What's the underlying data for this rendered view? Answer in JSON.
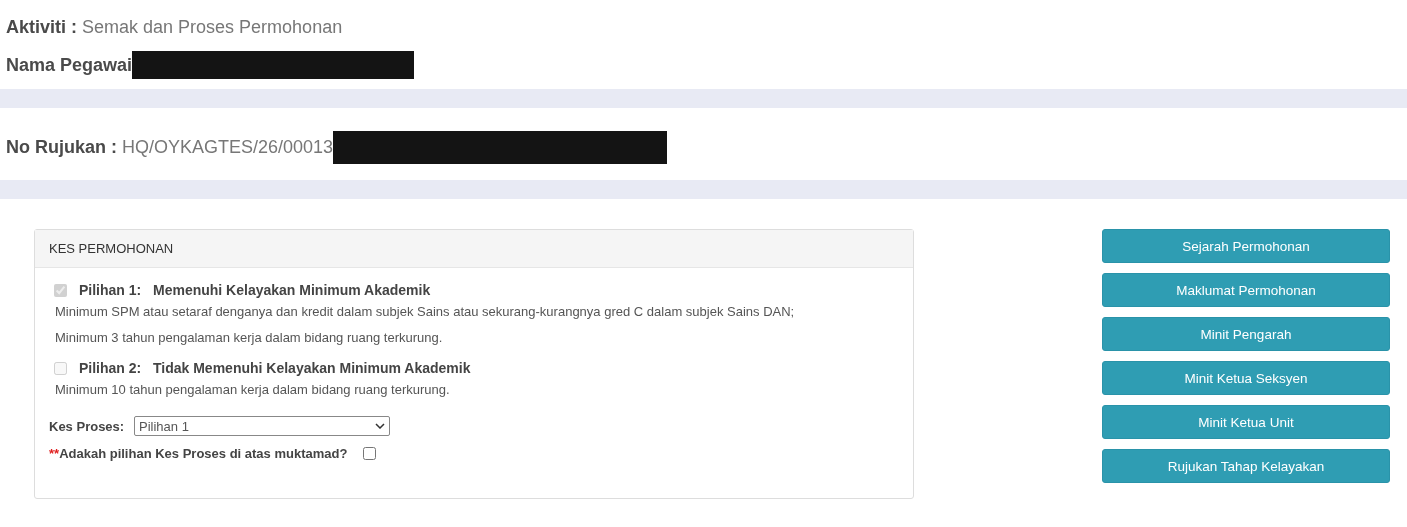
{
  "header": {
    "activity": {
      "label": "Aktiviti :",
      "value": "Semak dan Proses Permohonan"
    },
    "officer": {
      "label": "Nama Pegawai"
    }
  },
  "reference": {
    "label": "No Rujukan :",
    "value": "HQ/OYKAGTES/26/00013"
  },
  "card": {
    "title": "KES PERMOHONAN",
    "options": [
      {
        "label": "Pilihan 1:",
        "title": "Memenuhi Kelayakan Minimum Akademik",
        "checked": true,
        "disabled": true,
        "lines": [
          "Minimum SPM atau setaraf denganya dan kredit dalam subjek Sains atau sekurang-kurangnya gred C dalam subjek Sains DAN;",
          "Minimum 3 tahun pengalaman kerja dalam bidang ruang terkurung."
        ]
      },
      {
        "label": "Pilihan 2:",
        "title": "Tidak Memenuhi Kelayakan Minimum Akademik",
        "checked": false,
        "disabled": true,
        "lines": [
          "Minimum 10 tahun pengalaman kerja dalam bidang ruang terkurung."
        ]
      }
    ],
    "process": {
      "label": "Kes Proses:",
      "value": "Pilihan 1"
    },
    "confirm": {
      "required_mark": "**",
      "label": "Adakah pilihan Kes Proses di atas muktamad?",
      "checked": false
    }
  },
  "buttons": [
    "Sejarah Permohonan",
    "Maklumat Permohonan",
    "Minit Pengarah",
    "Minit Ketua Seksyen",
    "Minit Ketua Unit",
    "Rujukan Tahap Kelayakan"
  ]
}
